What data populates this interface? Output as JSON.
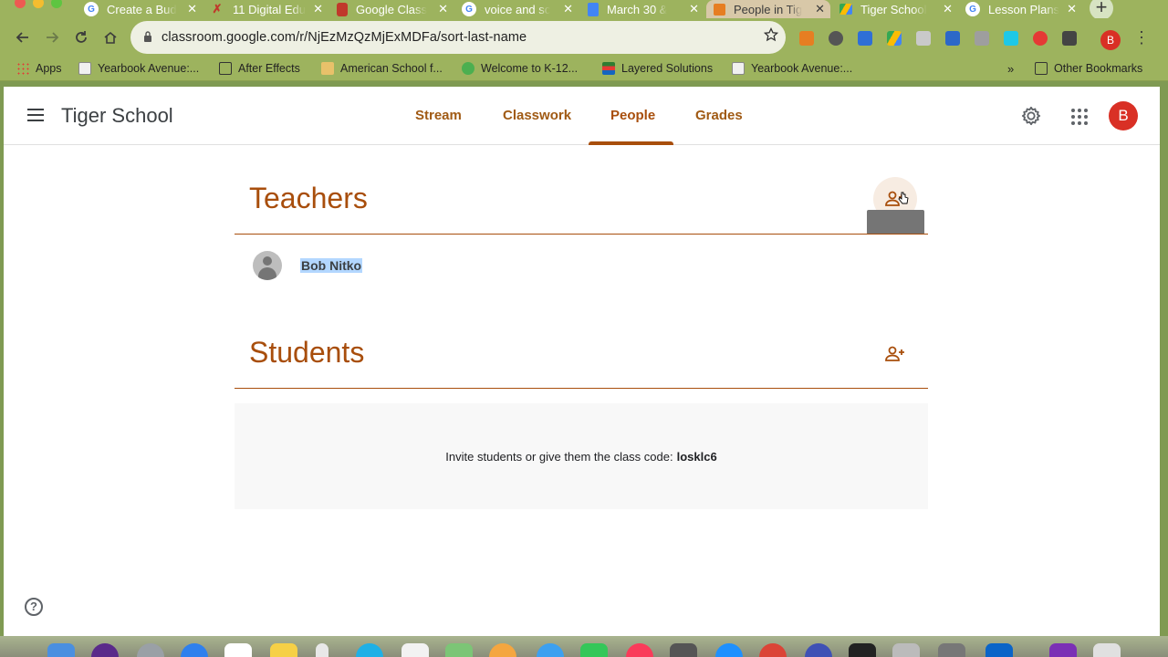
{
  "browser": {
    "tabs": [
      {
        "title": "Create a Bud",
        "favicon": "google-g-icon",
        "active": false
      },
      {
        "title": "11 Digital Edu",
        "favicon": "x-logo-icon",
        "active": false
      },
      {
        "title": "Google Class",
        "favicon": "google-classroom-icon",
        "active": false
      },
      {
        "title": "voice and sc",
        "favicon": "google-g-icon",
        "active": false
      },
      {
        "title": "March 30 &",
        "favicon": "google-docs-icon",
        "active": false
      },
      {
        "title": "People in Tig",
        "favicon": "google-classroom-icon",
        "active": true
      },
      {
        "title": "Tiger School",
        "favicon": "google-drive-icon",
        "active": false
      },
      {
        "title": "Lesson Plans",
        "favicon": "google-g-icon",
        "active": false
      }
    ],
    "new_tab_label": "+",
    "close_glyph": "✕",
    "url": "classroom.google.com/r/NjEzMzQzMjExMDFa/sort-last-name",
    "profile_initial": "B",
    "bookmarks": [
      {
        "label": "Apps",
        "icon": "apps-grid-icon"
      },
      {
        "label": "Yearbook Avenue:...",
        "icon": "yearbook-icon"
      },
      {
        "label": "After Effects",
        "icon": "folder-icon"
      },
      {
        "label": "American School f...",
        "icon": "school-icon"
      },
      {
        "label": "Welcome to K-12...",
        "icon": "k12-icon"
      },
      {
        "label": "Layered Solutions",
        "icon": "layers-icon"
      },
      {
        "label": "Yearbook Avenue:...",
        "icon": "yearbook-icon"
      }
    ],
    "overflow_label": "»",
    "other_bookmarks": "Other Bookmarks"
  },
  "classroom": {
    "class_name": "Tiger School",
    "nav": [
      {
        "label": "Stream",
        "active": false
      },
      {
        "label": "Classwork",
        "active": false
      },
      {
        "label": "People",
        "active": true
      },
      {
        "label": "Grades",
        "active": false
      }
    ],
    "user_initial": "B",
    "teachers_heading": "Teachers",
    "teachers": [
      {
        "name": "Bob Nitko",
        "selected": true
      }
    ],
    "students_heading": "Students",
    "empty_message": "Invite students or give them the class code:",
    "class_code": "losklc6",
    "help_glyph": "?"
  },
  "colors": {
    "accent": "#a84e0c",
    "tab_strip": "#9db35e",
    "avatar_red": "#d93025"
  }
}
